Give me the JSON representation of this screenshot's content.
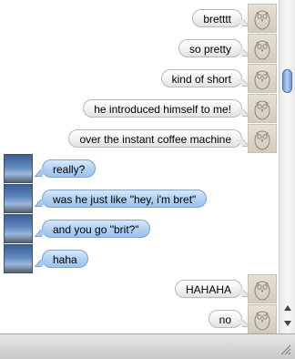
{
  "conversation": {
    "messages": [
      {
        "sender": "me",
        "text": "bretttt"
      },
      {
        "sender": "me",
        "text": "so pretty"
      },
      {
        "sender": "me",
        "text": "kind of short"
      },
      {
        "sender": "me",
        "text": "he introduced himself to me!"
      },
      {
        "sender": "me",
        "text": "over the instant coffee machine"
      },
      {
        "sender": "them",
        "text": "really?"
      },
      {
        "sender": "them",
        "text": "was he just like \"hey, i'm bret\""
      },
      {
        "sender": "them",
        "text": "and you go \"brit?\""
      },
      {
        "sender": "them",
        "text": "haha"
      },
      {
        "sender": "me",
        "text": "HAHAHA"
      },
      {
        "sender": "me",
        "text": "no"
      }
    ]
  },
  "avatars": {
    "me": "owl-sketch-avatar",
    "them": "sky-photo-avatar"
  },
  "scrollbar": {
    "position_fraction": 0.2
  },
  "colors": {
    "incoming_bubble": "#b2d1f4",
    "outgoing_bubble": "#f2f2f2",
    "scroll_thumb": "#6d9ad6"
  }
}
